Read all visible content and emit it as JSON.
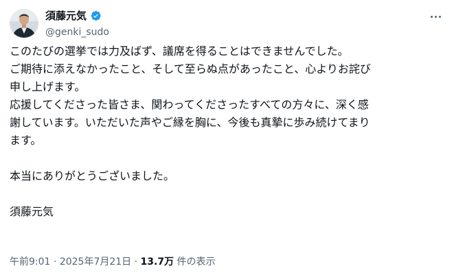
{
  "author": {
    "display_name": "須藤元気",
    "handle": "@genki_sudo",
    "verified": true
  },
  "tweet": {
    "lines": [
      "このたびの選挙では力及ばず、議席を得ることはできませんでした。",
      "ご期待に添えなかったこと、そして至らぬ点があったこと、心よりお詫び",
      "申し上げます。",
      "応援してくださった皆さま、関わってくださったすべての方々に、深く感",
      "謝しています。いただいた声やご縁を胸に、今後も真摯に歩み続けてまり",
      "ます。",
      "",
      "本当にありがとうございました。",
      "",
      "須藤元気"
    ]
  },
  "meta": {
    "time": "午前9:01",
    "separator1": " · ",
    "date": "2025年7月21日",
    "separator2": " · ",
    "views_count": "13.7万",
    "views_label": " 件の表示"
  },
  "colors": {
    "text": "#0f1419",
    "secondary": "#536471",
    "verified_badge": "#1d9bf0"
  },
  "icons": {
    "more": "more-options-icon",
    "verified": "verified-badge-icon"
  }
}
